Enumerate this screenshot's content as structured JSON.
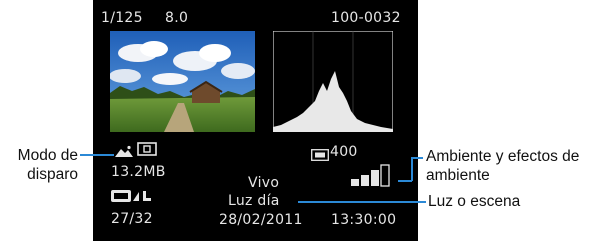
{
  "screen": {
    "shutter_speed": "1/125",
    "aperture": "8.0",
    "file_number": "100-0032",
    "iso": "400",
    "file_size": "13.2MB",
    "picture_style": "Vivo",
    "light_scene": "Luz día",
    "image_counter": "27/32",
    "date": "28/02/2011",
    "time": "13:30:00",
    "ambience_level": 3
  },
  "annotations": {
    "shooting_mode_line1": "Modo de",
    "shooting_mode_line2": "disparo",
    "ambience_line1": "Ambiente y efectos de",
    "ambience_line2": "ambiente",
    "light_scene": "Luz o escena"
  },
  "icons": {
    "shooting_mode": "scenic-intelligent-auto-icon",
    "metering": "evaluative-metering-icon",
    "quality": "raw-large-quality-icon",
    "iso": "iso-icon",
    "ambience": "ambience-level-bars-icon"
  },
  "colors": {
    "screen_bg": "#000000",
    "screen_text": "#e6e6e6",
    "leader_line": "#2b89d6",
    "label_text": "#111111"
  }
}
